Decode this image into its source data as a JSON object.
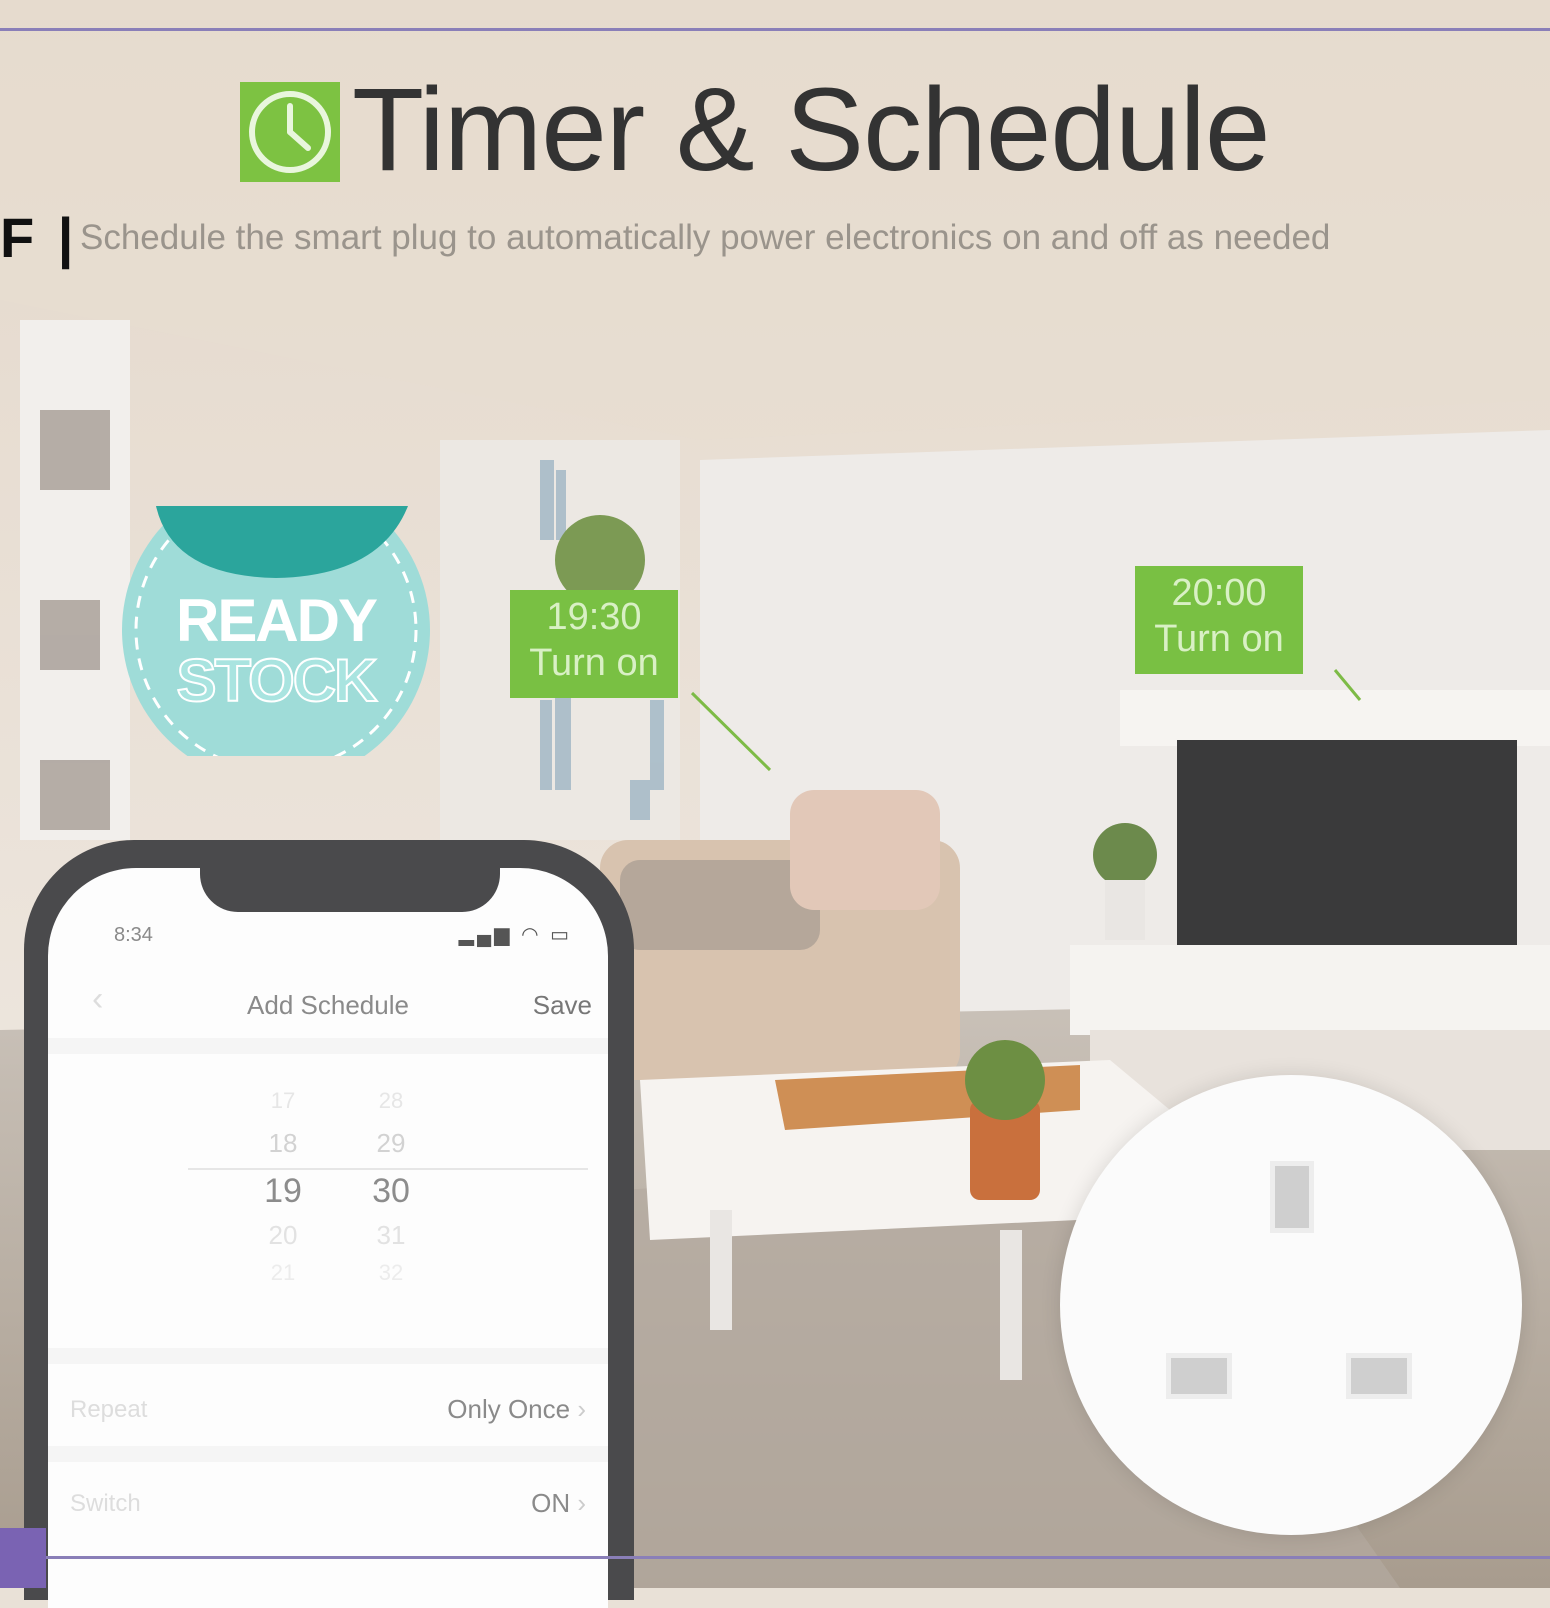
{
  "header": {
    "title": "Timer & Schedule",
    "subtitle": "Schedule the smart plug to automatically power electronics on and off as needed",
    "left_fragment": "F |"
  },
  "badge": {
    "line1": "READY",
    "line2": "STOCK"
  },
  "tags": [
    {
      "time": "19:30",
      "action": "Turn on"
    },
    {
      "time": "20:00",
      "action": "Turn on"
    }
  ],
  "phone": {
    "status_time": "8:34",
    "nav_title": "Add Schedule",
    "save_label": "Save",
    "back_icon": "‹",
    "hours": [
      "17",
      "18",
      "19",
      "20",
      "21"
    ],
    "minutes": [
      "28",
      "29",
      "30",
      "31",
      "32"
    ],
    "selected_hour": "19",
    "selected_minute": "30",
    "repeat_label": "Repeat",
    "repeat_value": "Only Once",
    "switch_label": "Switch",
    "switch_value": "ON",
    "chevron": "›"
  },
  "colors": {
    "accent_green": "#79c043",
    "badge_teal": "#a9e4e0",
    "rule_purple": "#8a7fb8"
  }
}
